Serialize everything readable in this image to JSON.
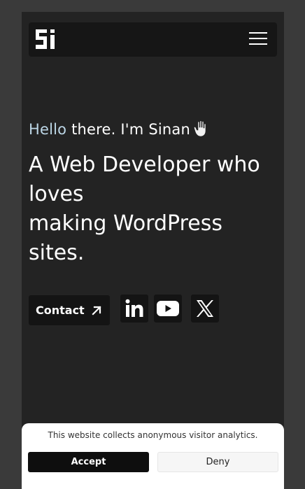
{
  "header": {
    "logo_icon": "si-logo-icon",
    "menu_icon": "hamburger-menu-icon"
  },
  "hero": {
    "greeting_highlight": "Hello",
    "greeting_rest": " there. I'm Sinan",
    "greeting_icon": "waving-hand-icon",
    "headline_lines": [
      "A Web Developer who",
      "loves",
      "making WordPress",
      "sites."
    ]
  },
  "actions": {
    "contact_label": "Contact",
    "contact_icon": "arrow-up-right-icon"
  },
  "social": [
    {
      "icon": "linkedin-icon"
    },
    {
      "icon": "youtube-icon"
    },
    {
      "icon": "x-twitter-icon"
    }
  ],
  "cookie_banner": {
    "text": "This website collects anonymous visitor analytics.",
    "accept_label": "Accept",
    "deny_label": "Deny"
  },
  "colors": {
    "background": "#232323",
    "surface": "#141414",
    "greeting_highlight": "#bcd6e6",
    "text": "#ffffff"
  }
}
